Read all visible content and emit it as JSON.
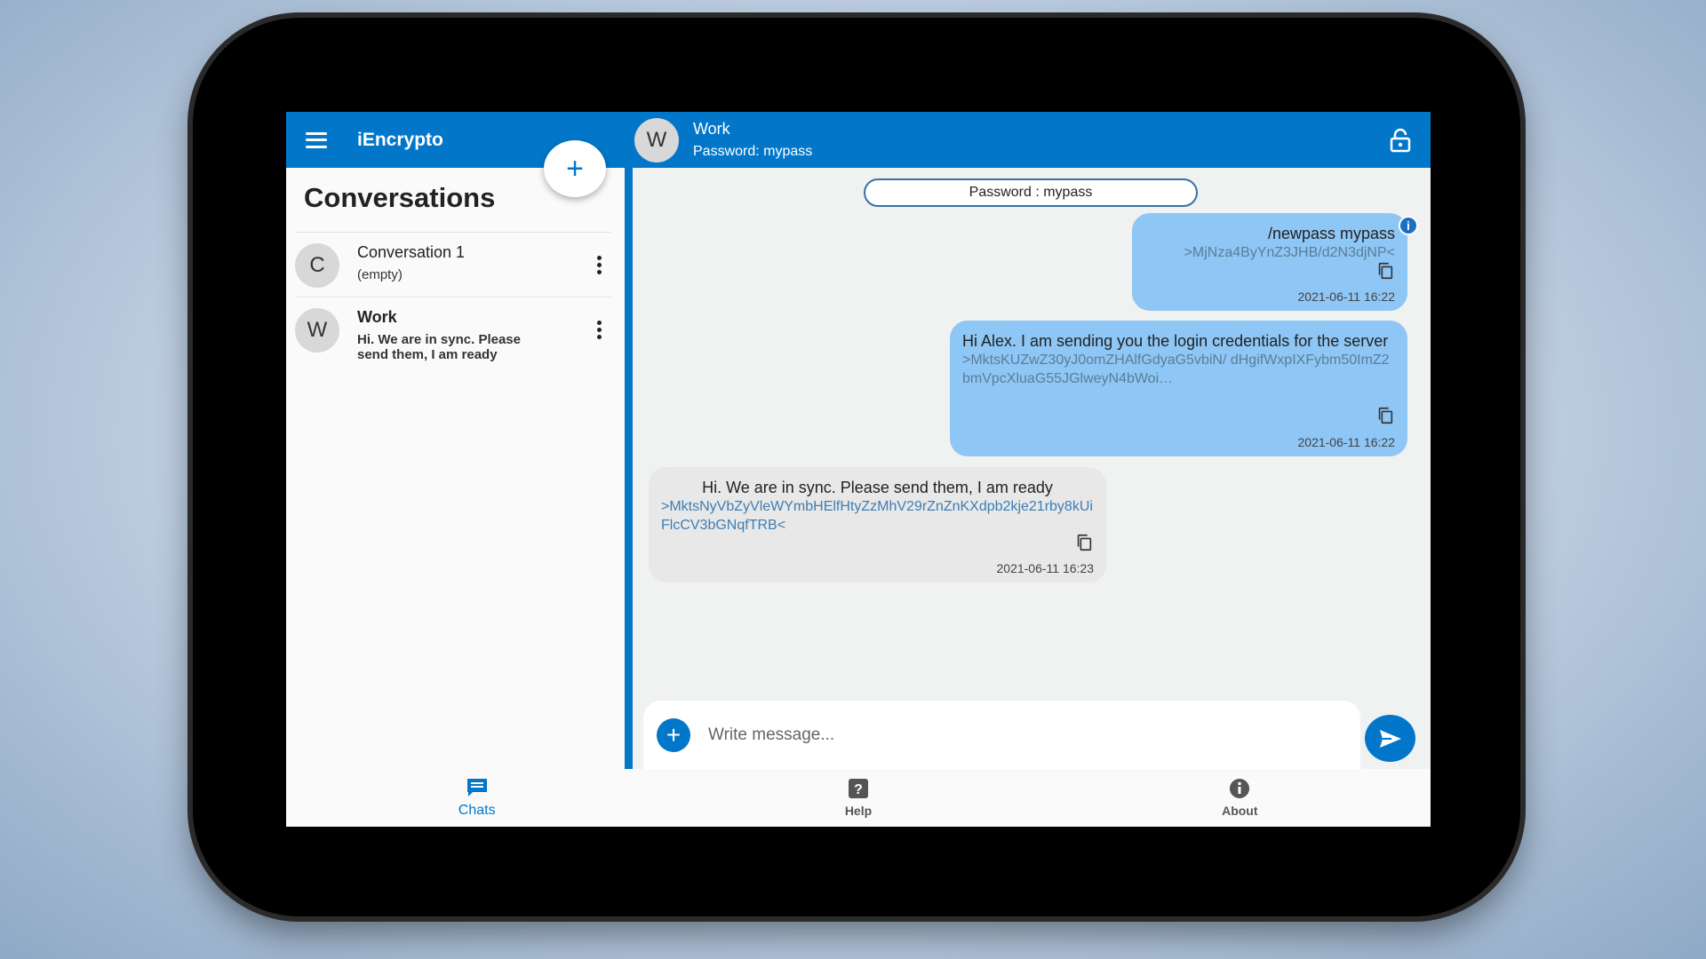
{
  "app": {
    "title": "iEncrypto"
  },
  "sidebar": {
    "heading": "Conversations",
    "add_label": "+",
    "conversations": [
      {
        "initial": "C",
        "name": "Conversation 1",
        "preview": "(empty)"
      },
      {
        "initial": "W",
        "name": "Work",
        "preview": "Hi. We are in sync. Please send them, I am ready"
      }
    ]
  },
  "chat": {
    "initial": "W",
    "name": "Work",
    "subtitle": "Password: mypass",
    "password_chip": "Password : mypass",
    "messages": [
      {
        "direction": "out",
        "text": "/newpass mypass",
        "cipher": ">MjNza4ByYnZ3JHB/d2N3djNP<",
        "time": "2021-06-11 16:22",
        "info": "i"
      },
      {
        "direction": "out",
        "text": "Hi Alex. I am sending you the login credentials for the server",
        "cipher": ">MktsKUZwZ30yJ0omZHAlfGdyaG5vbiN/ dHgifWxpIXFybm50ImZ2bmVpcXluaG55JGlweyN4bWoi…",
        "time": "2021-06-11 16:22"
      },
      {
        "direction": "in",
        "text": "Hi. We are in sync. Please send them, I am ready",
        "cipher": ">MktsNyVbZyVleWYmbHElfHtyZzMhV29rZnZnKXdpb2kje21rby8kUiFlcCV3bGNqfTRB<",
        "time": "2021-06-11 16:23"
      }
    ]
  },
  "composer": {
    "placeholder": "Write message..."
  },
  "nav": [
    {
      "label": "Chats",
      "icon": "chat-icon",
      "active": true
    },
    {
      "label": "Help",
      "icon": "help-icon"
    },
    {
      "label": "About",
      "icon": "info-icon"
    }
  ],
  "colors": {
    "primary": "#0277c9",
    "bubble_out": "#8ec6f5",
    "bubble_in": "#e8e8e8"
  }
}
